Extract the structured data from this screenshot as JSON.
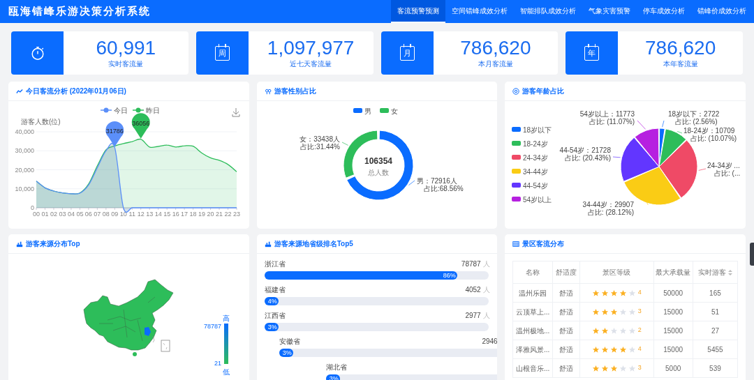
{
  "header": {
    "title": "瓯海错峰乐游决策分析系统",
    "tabs": [
      {
        "label": "客流预警预测",
        "selected": true
      },
      {
        "label": "空间错峰成效分析",
        "selected": false
      },
      {
        "label": "智能排队成效分析",
        "selected": false
      },
      {
        "label": "气象灾害预警",
        "selected": false
      },
      {
        "label": "停车成效分析",
        "selected": false
      },
      {
        "label": "错峰价成效分析",
        "selected": false
      }
    ]
  },
  "stats": [
    {
      "kind": "stopwatch",
      "value": "60,991",
      "label": "实时客流量"
    },
    {
      "kind": "calendar",
      "icon_text": "周",
      "value": "1,097,977",
      "label": "近七天客流量"
    },
    {
      "kind": "calendar",
      "icon_text": "月",
      "value": "786,620",
      "label": "本月客流量"
    },
    {
      "kind": "calendar",
      "icon_text": "年",
      "value": "786,620",
      "label": "本年客流量"
    }
  ],
  "flow_panel": {
    "title": "今日客流分析 (2022年01月06日)",
    "chart_data": {
      "type": "area",
      "ylabel": "游客人数(位)",
      "grid": true,
      "legend": true,
      "x": [
        "00",
        "01",
        "02",
        "03",
        "04",
        "05",
        "06",
        "07",
        "08",
        "09",
        "10",
        "11",
        "12",
        "13",
        "14",
        "15",
        "16",
        "17",
        "18",
        "19",
        "20",
        "21",
        "22",
        "23"
      ],
      "ylim": [
        0,
        40000
      ],
      "yticks": [
        0,
        {
          "value": 10000,
          "label": "10,000"
        },
        {
          "value": 20000,
          "label": "20,000"
        },
        {
          "value": 30000,
          "label": "30,000"
        },
        {
          "value": 40000,
          "label": "40,000"
        }
      ],
      "series": [
        {
          "name": "今日",
          "color": "#5b8ff9",
          "values": [
            14000,
            10500,
            8800,
            7800,
            7400,
            7700,
            12000,
            21000,
            30000,
            31786,
            0,
            0,
            0,
            0,
            0,
            0,
            0,
            0,
            0,
            0,
            0,
            0,
            0,
            0
          ]
        },
        {
          "name": "昨日",
          "color": "#2dbd5a",
          "values": [
            14000,
            10500,
            8800,
            7800,
            7400,
            7800,
            12500,
            22000,
            30500,
            32500,
            33800,
            34800,
            36056,
            32000,
            32300,
            33000,
            32000,
            32600,
            32400,
            28800,
            26300,
            25000,
            22800,
            19000
          ]
        }
      ],
      "annotations": [
        {
          "x": "09",
          "y": 31786,
          "text": "31786"
        },
        {
          "x": "12",
          "y": 36056,
          "text": "36056"
        }
      ]
    }
  },
  "gender_panel": {
    "title": "游客性别占比",
    "center_value": "106354",
    "center_label": "总人数",
    "chart_data": {
      "type": "donut",
      "legend": true,
      "categories": [
        "男",
        "女"
      ],
      "series": [
        {
          "values": [
            68.56,
            31.44
          ]
        }
      ],
      "colors": [
        "#0a6cff",
        "#2dbd5a"
      ],
      "value_labels": [
        [
          "男：72916人",
          "占比:68.56%"
        ],
        [
          "女：33438人",
          "占比:31.44%"
        ]
      ]
    }
  },
  "age_panel": {
    "title": "游客年龄占比",
    "chart_data": {
      "type": "pie",
      "legend": true,
      "categories": [
        "18岁以下",
        "18-24岁",
        "24-34岁",
        "34-44岁",
        "44-54岁",
        "54岁以上"
      ],
      "series": [
        {
          "values": [
            2.56,
            10.07,
            27.75,
            28.12,
            20.43,
            11.07
          ]
        }
      ],
      "colors": [
        "#0a6cff",
        "#2dbd5a",
        "#ef4a66",
        "#facc15",
        "#6236ff",
        "#b620e0"
      ],
      "value_labels": [
        [
          "18岁以下：2722",
          "占比: (2.56%)"
        ],
        [
          "18-24岁：10709",
          "占比: (10.07%)"
        ],
        [
          "24-34岁 ...",
          "占比: (..."
        ],
        [
          "34-44岁：29907",
          "占比: (28.12%)"
        ],
        [
          "44-54岁：21728",
          "占比: (20.43%)"
        ],
        [
          "54岁以上：11773",
          "占比: (11.07%)"
        ]
      ]
    }
  },
  "map_panel": {
    "title": "游客来源分布Top",
    "legend": {
      "high": "高",
      "max": "78787",
      "min": "21",
      "low": "低"
    }
  },
  "rank_panel": {
    "title": "游客来源地省级排名Top5",
    "items": [
      {
        "name": "浙江省",
        "count": "78787",
        "unit": "人",
        "level": 0.86,
        "percent": "86%"
      },
      {
        "name": "福建省",
        "count": "4052",
        "unit": "人",
        "level": 0.04,
        "percent": "4%"
      },
      {
        "name": "江西省",
        "count": "2977",
        "unit": "人",
        "level": 0.03,
        "percent": "3%"
      },
      {
        "name": "安徽省",
        "count": "2946",
        "level": 0.03,
        "percent": "3%"
      },
      {
        "name": "湖北省",
        "level": 0.03,
        "percent": "3%"
      }
    ]
  },
  "table_panel": {
    "title": "景区客流分布",
    "columns": [
      "名称",
      "舒适度",
      "景区等级",
      "最大承载量",
      "实时游客"
    ],
    "rows": [
      {
        "name": "温州乐园",
        "comfort": "舒适",
        "stars": 4,
        "grade": "4",
        "capacity": "50000",
        "visitors": "165"
      },
      {
        "name": "云顶草上...",
        "comfort": "舒适",
        "stars": 3,
        "grade": "3",
        "capacity": "15000",
        "visitors": "51"
      },
      {
        "name": "温州极地...",
        "comfort": "舒适",
        "stars": 2,
        "grade": "2",
        "capacity": "15000",
        "visitors": "27"
      },
      {
        "name": "泽雅风景...",
        "comfort": "舒适",
        "stars": 4,
        "grade": "4",
        "capacity": "15000",
        "visitors": "5455"
      },
      {
        "name": "山根音乐...",
        "comfort": "舒适",
        "stars": 3,
        "grade": "3",
        "capacity": "5000",
        "visitors": "539"
      }
    ]
  }
}
